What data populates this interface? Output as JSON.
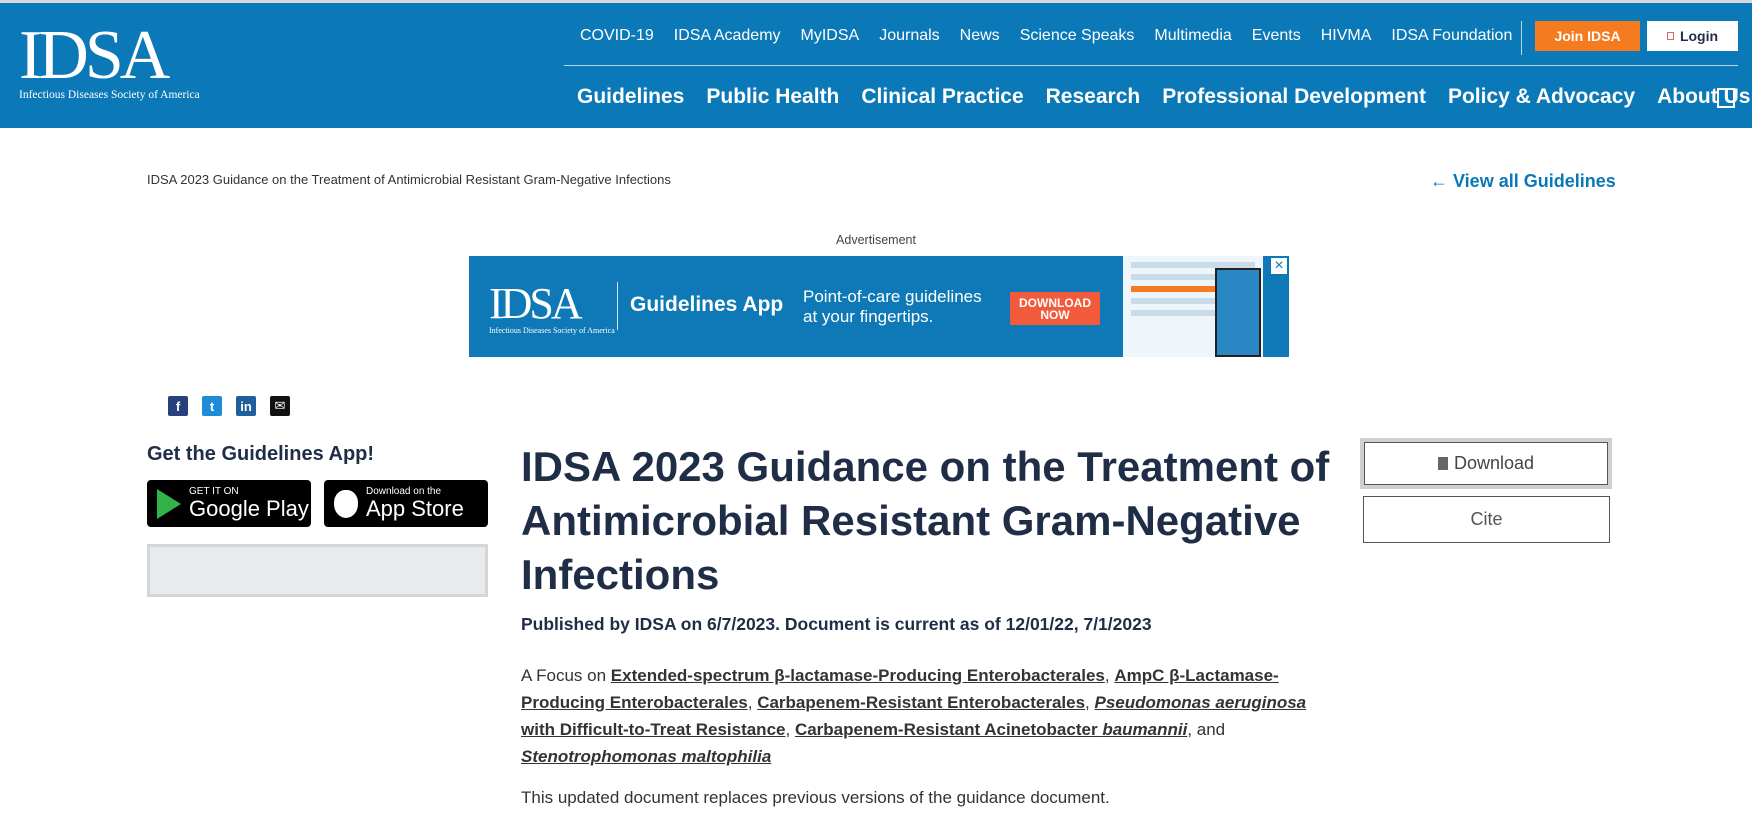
{
  "header": {
    "logo_mark": "IDSA",
    "logo_sub": "Infectious Diseases Society of America",
    "util_nav": [
      "COVID-19",
      "IDSA Academy",
      "MyIDSA",
      "Journals",
      "News",
      "Science Speaks",
      "Multimedia",
      "Events",
      "HIVMA",
      "IDSA Foundation"
    ],
    "join_label": "Join IDSA",
    "login_label": "Login",
    "main_nav": [
      "Guidelines",
      "Public Health",
      "Clinical Practice",
      "Research",
      "Professional Development",
      "Policy & Advocacy",
      "About Us"
    ]
  },
  "breadcrumb": "IDSA 2023 Guidance on the Treatment of Antimicrobial Resistant Gram-Negative Infections",
  "view_all": "← View all Guidelines",
  "ad": {
    "label": "Advertisement",
    "logo": "IDSA",
    "logo_sub": "Infectious Diseases Society of America",
    "app": "Guidelines App",
    "tag_line1": "Point-of-care guidelines",
    "tag_line2": "at your fingertips.",
    "download_line1": "DOWNLOAD",
    "download_line2": "NOW",
    "close": "×"
  },
  "share": {
    "facebook": "f",
    "twitter": "t",
    "linkedin": "in",
    "email": "✉"
  },
  "sidebar": {
    "app_title": "Get the Guidelines App!",
    "google_small": "GET IT ON",
    "google_big": "Google Play",
    "apple_small": "Download on the",
    "apple_big": "App Store"
  },
  "article": {
    "title": "IDSA 2023 Guidance on the Treatment of Antimicrobial Resistant Gram-Negative Infections",
    "published": "Published by IDSA on 6/7/2023. Document is current as of 12/01/22, 7/1/2023",
    "focus_prefix": "A Focus on ",
    "focus_links": [
      "Extended-spectrum β-lactamase-Producing Enterobacterales",
      "AmpC β-Lactamase-Producing Enterobacterales",
      "Carbapenem-Resistant Enterobacterales",
      "Pseudomonas aeruginosa",
      "with Difficult-to-Treat Resistance",
      "Carbapenem-Resistant Acinetobacter ",
      "baumannii",
      "Stenotrophomonas maltophilia"
    ],
    "comma": ",",
    "and": ", and",
    "replaces": "This updated document replaces previous versions of the guidance document."
  },
  "actions": {
    "download": "Download",
    "cite": "Cite"
  }
}
